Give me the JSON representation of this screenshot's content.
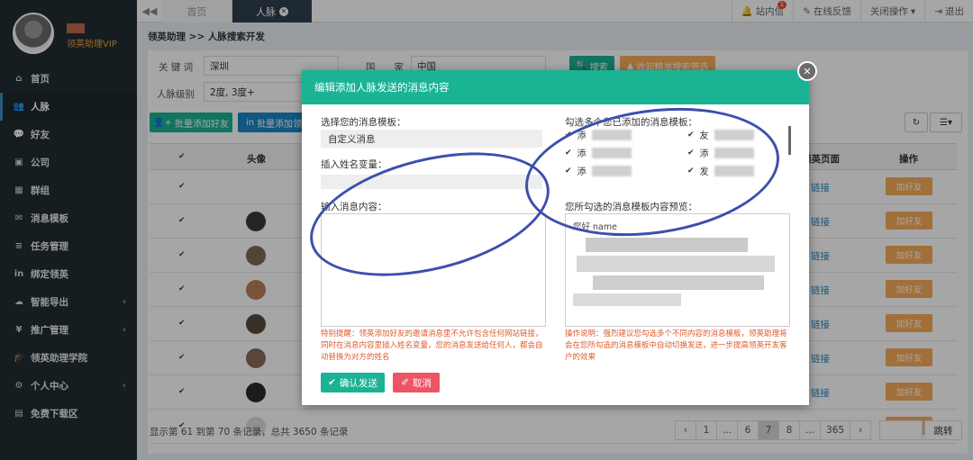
{
  "user": {
    "vip_label": "领英助理VIP"
  },
  "sidebar": {
    "items": [
      {
        "label": "首页",
        "icon": "home-icon",
        "glyph": "⌂"
      },
      {
        "label": "人脉",
        "icon": "users-icon",
        "glyph": "👥"
      },
      {
        "label": "好友",
        "icon": "chat-icon",
        "glyph": "💬"
      },
      {
        "label": "公司",
        "icon": "briefcase-icon",
        "glyph": "▣"
      },
      {
        "label": "群组",
        "icon": "group-icon",
        "glyph": "▦"
      },
      {
        "label": "消息模板",
        "icon": "envelope-icon",
        "glyph": "✉"
      },
      {
        "label": "任务管理",
        "icon": "tasks-icon",
        "glyph": "≡"
      },
      {
        "label": "绑定领英",
        "icon": "linkedin-icon",
        "glyph": "in"
      },
      {
        "label": "智能导出",
        "icon": "cloud-download-icon",
        "glyph": "☁"
      },
      {
        "label": "推广管理",
        "icon": "yen-icon",
        "glyph": "¥"
      },
      {
        "label": "领英助理学院",
        "icon": "graduation-icon",
        "glyph": "🎓"
      },
      {
        "label": "个人中心",
        "icon": "gear-icon",
        "glyph": "⚙"
      },
      {
        "label": "免费下载区",
        "icon": "file-icon",
        "glyph": "▤"
      }
    ]
  },
  "topbar": {
    "home_tab": "首页",
    "active_tab": "人脉",
    "notice": "站内信",
    "notice_count": "1",
    "feedback": "在线反馈",
    "close_ops": "关闭操作",
    "logout": "退出"
  },
  "breadcrumb": "领英助理 >> 人脉搜索开发",
  "filters": {
    "keyword_label": "关 键 词",
    "keyword_value": "深圳",
    "country_label": "国　　家",
    "country_value": "中国",
    "level_label": "人脉级别",
    "level_value": "2度, 3度+",
    "search_btn": "搜索",
    "collapse_btn": "收起精准搜索筛选"
  },
  "actions": {
    "batch_add_friend": "批量添加好友",
    "batch_add_linkedin": "批量添加领"
  },
  "table": {
    "col_avatar": "头像",
    "col_page": "领英页面",
    "col_ops": "操作",
    "link_label": "链接",
    "add_friend": "加好友"
  },
  "footer": {
    "summary": "显示第 61 到第 70 条记录，总共 3650 条记录",
    "pages": [
      "‹",
      "1",
      "...",
      "6",
      "7",
      "8",
      "...",
      "365",
      "›"
    ],
    "current_page": "7",
    "jump": "跳转"
  },
  "modal": {
    "title": "编辑添加人脉发送的消息内容",
    "select_template_label": "选择您的消息模板：",
    "select_template_value": "自定义消息",
    "insert_var_label": "插入姓名变量：",
    "input_msg_label": "输入消息内容：",
    "multi_tpl_label": "勾选多个您已添加的消息模板：",
    "templates": [
      "添",
      "友",
      "添",
      "添",
      "添",
      "发"
    ],
    "preview_label": "您所勾选的消息模板内容预览：",
    "preview_text": "您好 name",
    "warning": "特别提醒：领英添加好友的邀请消息里不允许包含任何网站链接，同时在消息内容里插入姓名变量，您的消息发送给任何人，都会自动替换为对方的姓名",
    "note": "操作说明：强烈建议您勾选多个不同内容的消息模板，领英助理将会在您所勾选的消息模板中自动切换发送，进一步提高领英开发客户的效果",
    "confirm": "确认发送",
    "cancel": "取消"
  }
}
